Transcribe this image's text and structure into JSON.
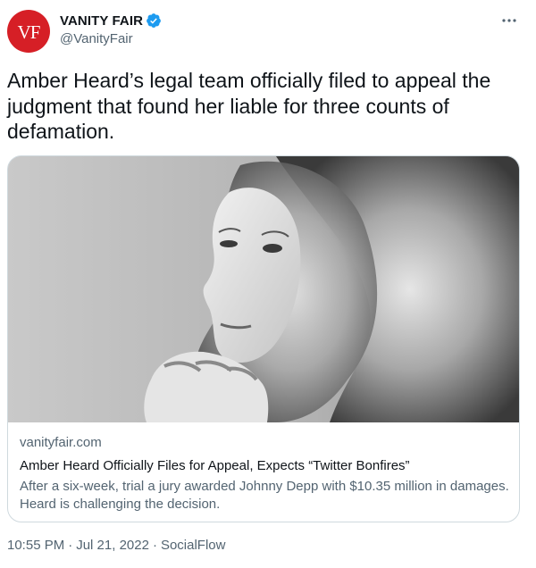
{
  "account": {
    "display_name": "VANITY FAIR",
    "handle": "@VanityFair",
    "avatar_text": "VF",
    "verified": true
  },
  "tweet": {
    "text": "Amber Heard’s legal team officially filed to appeal the judgment that found her liable for three counts of defamation."
  },
  "card": {
    "domain": "vanityfair.com",
    "title": "Amber Heard Officially Files for Appeal, Expects “Twitter Bonfires”",
    "description": "After a six-week, trial a jury awarded Johnny Depp with $10.35 million in damages. Heard is challenging the decision."
  },
  "meta": {
    "time": "10:55 PM",
    "separator": "·",
    "date": "Jul 21, 2022",
    "source": "SocialFlow"
  },
  "colors": {
    "brand_red": "#d61f26",
    "verified_blue": "#1d9bf0",
    "secondary_text": "#536471",
    "border": "#cfd9de"
  },
  "icons": {
    "verified": "verified-badge-icon",
    "more": "more-horizontal-icon"
  }
}
